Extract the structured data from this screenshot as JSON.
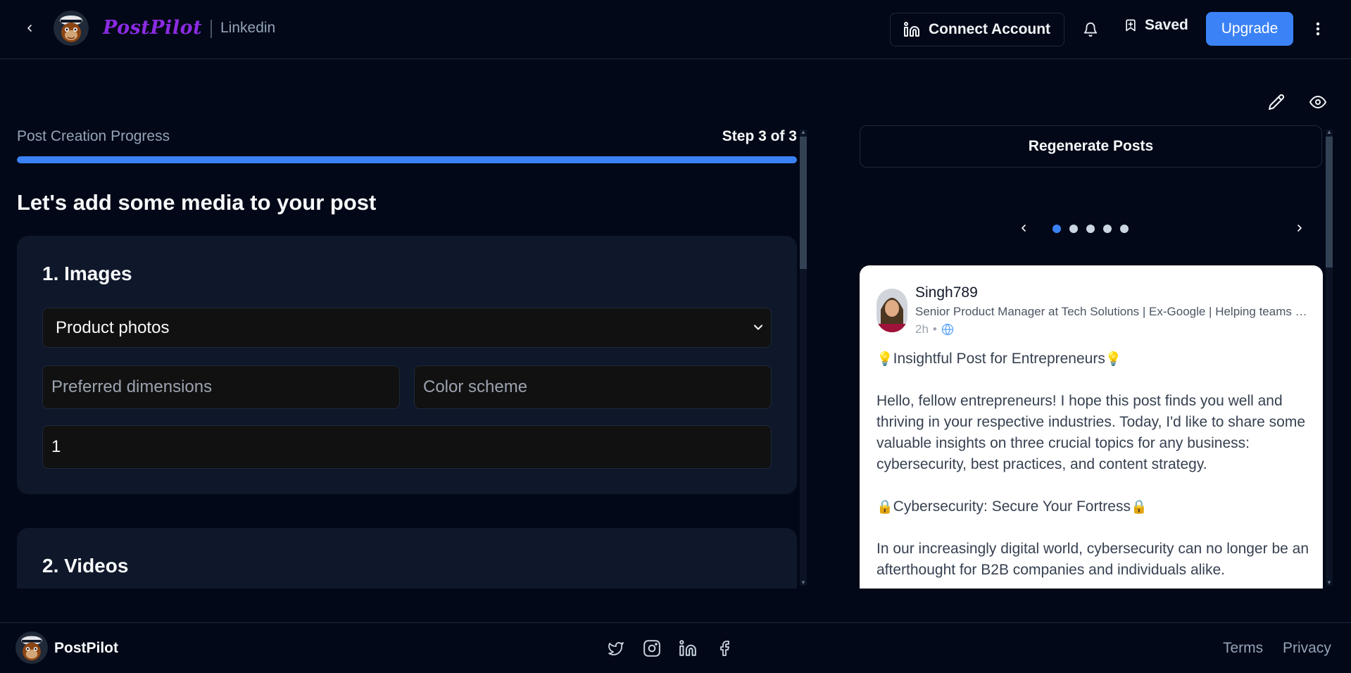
{
  "header": {
    "brand": "PostPilot",
    "platform": "Linkedin",
    "connect_label": "Connect Account",
    "saved_label": "Saved",
    "upgrade_label": "Upgrade"
  },
  "progress": {
    "label": "Post Creation Progress",
    "step_text": "Step 3 of 3",
    "fraction": 1.0
  },
  "media": {
    "title": "Let's add some media to your post",
    "images": {
      "heading": "1. Images",
      "type_selected": "Product photos",
      "dimensions_placeholder": "Preferred dimensions",
      "color_scheme_placeholder": "Color scheme",
      "count_value": "1"
    },
    "videos": {
      "heading": "2. Videos"
    }
  },
  "preview": {
    "regenerate_label": "Regenerate Posts",
    "carousel": {
      "count": 5,
      "active": 0
    },
    "post": {
      "author": "Singh789",
      "headline": "Senior Product Manager at Tech Solutions | Ex-Google | Helping teams build products users love",
      "time": "2h",
      "title_line": "Insightful Post for Entrepreneurs",
      "intro": "Hello, fellow entrepreneurs! I hope this post finds you well and thriving in your respective industries. Today, I'd like to share some valuable insights on three crucial topics for any business: cybersecurity, best practices, and content strategy.",
      "section1_title": "Cybersecurity: Secure Your Fortress",
      "section1_text": "In our increasingly digital world, cybersecurity can no longer be an afterthought for B2B companies and individuals alike."
    }
  },
  "footer": {
    "brand": "PostPilot",
    "terms": "Terms",
    "privacy": "Privacy"
  },
  "colors": {
    "background": "#020817",
    "accent": "#3b82f6",
    "brand": "#8b2be2",
    "card": "#0f172a"
  }
}
